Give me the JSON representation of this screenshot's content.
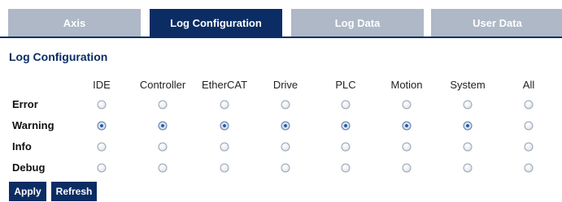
{
  "tabs": [
    {
      "label": "Axis",
      "active": false
    },
    {
      "label": "Log Configuration",
      "active": true
    },
    {
      "label": "Log Data",
      "active": false
    },
    {
      "label": "User Data",
      "active": false
    }
  ],
  "section_title": "Log Configuration",
  "columns": [
    "IDE",
    "Controller",
    "EtherCAT",
    "Drive",
    "PLC",
    "Motion",
    "System",
    "All"
  ],
  "rows": [
    {
      "label": "Error",
      "selected": []
    },
    {
      "label": "Warning",
      "selected": [
        "IDE",
        "Controller",
        "EtherCAT",
        "Drive",
        "PLC",
        "Motion",
        "System"
      ]
    },
    {
      "label": "Info",
      "selected": []
    },
    {
      "label": "Debug",
      "selected": []
    }
  ],
  "buttons": {
    "apply": "Apply",
    "refresh": "Refresh"
  },
  "colors": {
    "accent": "#0c2d64",
    "inactive_tab": "#aeb8c6"
  }
}
